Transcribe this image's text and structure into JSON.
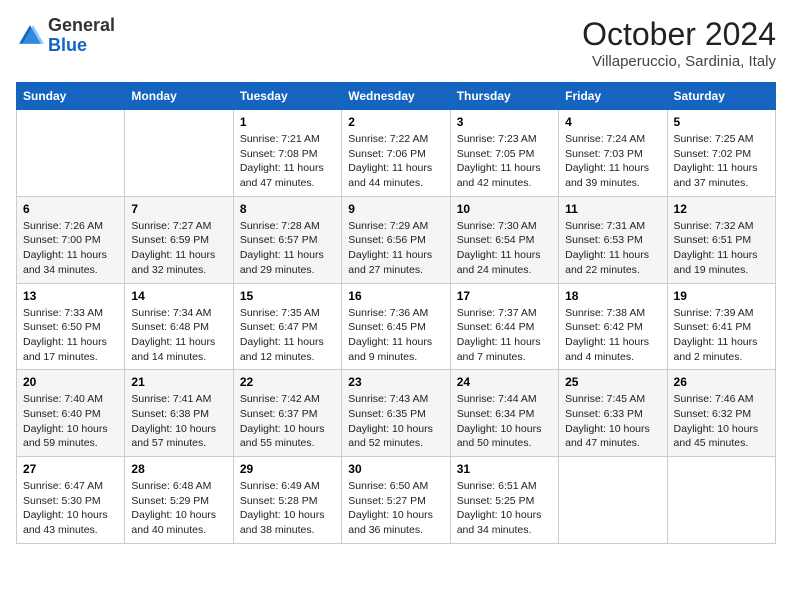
{
  "header": {
    "logo_general": "General",
    "logo_blue": "Blue",
    "month_title": "October 2024",
    "location": "Villaperuccio, Sardinia, Italy"
  },
  "days_of_week": [
    "Sunday",
    "Monday",
    "Tuesday",
    "Wednesday",
    "Thursday",
    "Friday",
    "Saturday"
  ],
  "weeks": [
    [
      {
        "day": "",
        "info": ""
      },
      {
        "day": "",
        "info": ""
      },
      {
        "day": "1",
        "info": "Sunrise: 7:21 AM\nSunset: 7:08 PM\nDaylight: 11 hours and 47 minutes."
      },
      {
        "day": "2",
        "info": "Sunrise: 7:22 AM\nSunset: 7:06 PM\nDaylight: 11 hours and 44 minutes."
      },
      {
        "day": "3",
        "info": "Sunrise: 7:23 AM\nSunset: 7:05 PM\nDaylight: 11 hours and 42 minutes."
      },
      {
        "day": "4",
        "info": "Sunrise: 7:24 AM\nSunset: 7:03 PM\nDaylight: 11 hours and 39 minutes."
      },
      {
        "day": "5",
        "info": "Sunrise: 7:25 AM\nSunset: 7:02 PM\nDaylight: 11 hours and 37 minutes."
      }
    ],
    [
      {
        "day": "6",
        "info": "Sunrise: 7:26 AM\nSunset: 7:00 PM\nDaylight: 11 hours and 34 minutes."
      },
      {
        "day": "7",
        "info": "Sunrise: 7:27 AM\nSunset: 6:59 PM\nDaylight: 11 hours and 32 minutes."
      },
      {
        "day": "8",
        "info": "Sunrise: 7:28 AM\nSunset: 6:57 PM\nDaylight: 11 hours and 29 minutes."
      },
      {
        "day": "9",
        "info": "Sunrise: 7:29 AM\nSunset: 6:56 PM\nDaylight: 11 hours and 27 minutes."
      },
      {
        "day": "10",
        "info": "Sunrise: 7:30 AM\nSunset: 6:54 PM\nDaylight: 11 hours and 24 minutes."
      },
      {
        "day": "11",
        "info": "Sunrise: 7:31 AM\nSunset: 6:53 PM\nDaylight: 11 hours and 22 minutes."
      },
      {
        "day": "12",
        "info": "Sunrise: 7:32 AM\nSunset: 6:51 PM\nDaylight: 11 hours and 19 minutes."
      }
    ],
    [
      {
        "day": "13",
        "info": "Sunrise: 7:33 AM\nSunset: 6:50 PM\nDaylight: 11 hours and 17 minutes."
      },
      {
        "day": "14",
        "info": "Sunrise: 7:34 AM\nSunset: 6:48 PM\nDaylight: 11 hours and 14 minutes."
      },
      {
        "day": "15",
        "info": "Sunrise: 7:35 AM\nSunset: 6:47 PM\nDaylight: 11 hours and 12 minutes."
      },
      {
        "day": "16",
        "info": "Sunrise: 7:36 AM\nSunset: 6:45 PM\nDaylight: 11 hours and 9 minutes."
      },
      {
        "day": "17",
        "info": "Sunrise: 7:37 AM\nSunset: 6:44 PM\nDaylight: 11 hours and 7 minutes."
      },
      {
        "day": "18",
        "info": "Sunrise: 7:38 AM\nSunset: 6:42 PM\nDaylight: 11 hours and 4 minutes."
      },
      {
        "day": "19",
        "info": "Sunrise: 7:39 AM\nSunset: 6:41 PM\nDaylight: 11 hours and 2 minutes."
      }
    ],
    [
      {
        "day": "20",
        "info": "Sunrise: 7:40 AM\nSunset: 6:40 PM\nDaylight: 10 hours and 59 minutes."
      },
      {
        "day": "21",
        "info": "Sunrise: 7:41 AM\nSunset: 6:38 PM\nDaylight: 10 hours and 57 minutes."
      },
      {
        "day": "22",
        "info": "Sunrise: 7:42 AM\nSunset: 6:37 PM\nDaylight: 10 hours and 55 minutes."
      },
      {
        "day": "23",
        "info": "Sunrise: 7:43 AM\nSunset: 6:35 PM\nDaylight: 10 hours and 52 minutes."
      },
      {
        "day": "24",
        "info": "Sunrise: 7:44 AM\nSunset: 6:34 PM\nDaylight: 10 hours and 50 minutes."
      },
      {
        "day": "25",
        "info": "Sunrise: 7:45 AM\nSunset: 6:33 PM\nDaylight: 10 hours and 47 minutes."
      },
      {
        "day": "26",
        "info": "Sunrise: 7:46 AM\nSunset: 6:32 PM\nDaylight: 10 hours and 45 minutes."
      }
    ],
    [
      {
        "day": "27",
        "info": "Sunrise: 6:47 AM\nSunset: 5:30 PM\nDaylight: 10 hours and 43 minutes."
      },
      {
        "day": "28",
        "info": "Sunrise: 6:48 AM\nSunset: 5:29 PM\nDaylight: 10 hours and 40 minutes."
      },
      {
        "day": "29",
        "info": "Sunrise: 6:49 AM\nSunset: 5:28 PM\nDaylight: 10 hours and 38 minutes."
      },
      {
        "day": "30",
        "info": "Sunrise: 6:50 AM\nSunset: 5:27 PM\nDaylight: 10 hours and 36 minutes."
      },
      {
        "day": "31",
        "info": "Sunrise: 6:51 AM\nSunset: 5:25 PM\nDaylight: 10 hours and 34 minutes."
      },
      {
        "day": "",
        "info": ""
      },
      {
        "day": "",
        "info": ""
      }
    ]
  ]
}
